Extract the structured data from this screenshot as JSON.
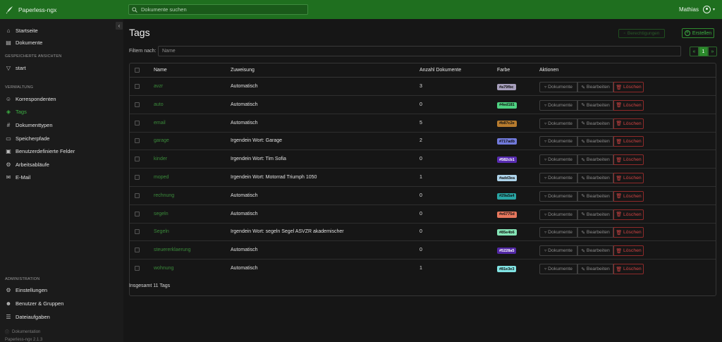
{
  "app": {
    "title": "Paperless-ngx"
  },
  "search": {
    "placeholder": "Dokumente suchen"
  },
  "user": {
    "name": "Mathias"
  },
  "sidebar": {
    "items_top": [
      {
        "label": "Startseite",
        "icon": "home-icon"
      },
      {
        "label": "Dokumente",
        "icon": "documents-icon"
      }
    ],
    "saved_views_heading": "GESPEICHERTE ANSICHTEN",
    "saved_views": [
      {
        "label": "start",
        "icon": "funnel-icon"
      }
    ],
    "management_heading": "VERWALTUNG",
    "management": [
      {
        "label": "Korrespondenten",
        "icon": "person-icon"
      },
      {
        "label": "Tags",
        "icon": "tag-icon"
      },
      {
        "label": "Dokumenttypen",
        "icon": "hash-icon"
      },
      {
        "label": "Speicherpfade",
        "icon": "folder-icon"
      },
      {
        "label": "Benutzerdefinierte Felder",
        "icon": "form-icon"
      },
      {
        "label": "Arbeitsabläufe",
        "icon": "workflow-icon"
      },
      {
        "label": "E-Mail",
        "icon": "mail-icon"
      }
    ],
    "admin_heading": "ADMINISTRATION",
    "admin": [
      {
        "label": "Einstellungen",
        "icon": "gear-icon"
      },
      {
        "label": "Benutzer & Gruppen",
        "icon": "people-icon"
      },
      {
        "label": "Dateiaufgaben",
        "icon": "list-icon"
      }
    ],
    "docs_label": "Dokumentation",
    "version_label": "Paperless-ngx 2.1.3"
  },
  "page": {
    "title": "Tags",
    "permissions_label": "Berechtigungen",
    "create_label": "Erstellen",
    "filter_label": "Filtern nach:",
    "filter_placeholder": "Name",
    "pager": {
      "prev": "«",
      "current": "1",
      "next": "»"
    },
    "total_label": "Insgesamt 11 Tags"
  },
  "table": {
    "headers": {
      "name": "Name",
      "assignment": "Zuweisung",
      "count": "Anzahl Dokumente",
      "color": "Farbe",
      "actions": "Aktionen"
    },
    "action_labels": {
      "documents": "Dokumente",
      "edit": "Bearbeiten",
      "delete": "Löschen"
    },
    "rows": [
      {
        "name": "avzr",
        "assignment": "Automatisch",
        "count": "3",
        "color": "#a79fbc",
        "text_color": "#111111"
      },
      {
        "name": "auto",
        "assignment": "Automatisch",
        "count": "0",
        "color": "#4ed181",
        "text_color": "#111111"
      },
      {
        "name": "email",
        "assignment": "Automatisch",
        "count": "5",
        "color": "#b87c2e",
        "text_color": "#111111"
      },
      {
        "name": "garage",
        "assignment": "Irgendein Wort: Garage",
        "count": "2",
        "color": "#717adb",
        "text_color": "#111111"
      },
      {
        "name": "kinder",
        "assignment": "Irgendein Wort: Tim Sofia",
        "count": "0",
        "color": "#582cb1",
        "text_color": "#ffffff"
      },
      {
        "name": "moped",
        "assignment": "Irgendein Wort: Motorrad Triumph 1050",
        "count": "1",
        "color": "#add3ea",
        "text_color": "#111111"
      },
      {
        "name": "rechnung",
        "assignment": "Automatisch",
        "count": "0",
        "color": "#29a5a4",
        "text_color": "#111111"
      },
      {
        "name": "segeln",
        "assignment": "Automatisch",
        "count": "0",
        "color": "#e6775d",
        "text_color": "#111111"
      },
      {
        "name": "Segeln",
        "assignment": "Irgendein Wort: segeln Segel ASVZR akademischer",
        "count": "0",
        "color": "#85e4b6",
        "text_color": "#111111"
      },
      {
        "name": "steuererklaerung",
        "assignment": "Automatisch",
        "count": "0",
        "color": "#5228a5",
        "text_color": "#ffffff"
      },
      {
        "name": "wohnung",
        "assignment": "Automatisch",
        "count": "1",
        "color": "#81e3e3",
        "text_color": "#111111"
      }
    ]
  }
}
